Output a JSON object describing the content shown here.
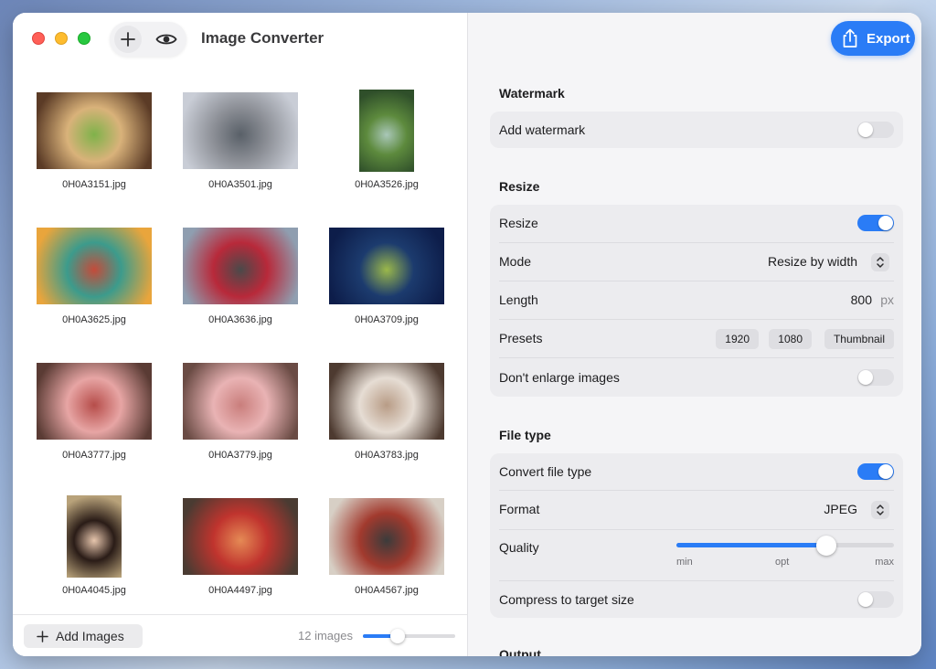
{
  "app": {
    "title": "Image Converter"
  },
  "toolbar": {
    "add_icon": "plus-icon",
    "preview_icon": "eye-icon"
  },
  "export": {
    "label": "Export",
    "icon": "share-icon"
  },
  "images": [
    {
      "name": "0H0A3151.jpg",
      "subject": "noodle bowl",
      "colors": [
        "#5b3b26",
        "#d9b27a",
        "#7fb24a"
      ]
    },
    {
      "name": "0H0A3501.jpg",
      "subject": "city buildings",
      "colors": [
        "#c9cdd6",
        "#8c8f96",
        "#596068"
      ]
    },
    {
      "name": "0H0A3526.jpg",
      "subject": "water basin moss",
      "colors": [
        "#2f4f2a",
        "#5d8a3d",
        "#a9c7b8"
      ]
    },
    {
      "name": "0H0A3625.jpg",
      "subject": "yellow fruits",
      "colors": [
        "#e9a53c",
        "#3c9b8c",
        "#c44b3a"
      ]
    },
    {
      "name": "0H0A3636.jpg",
      "subject": "red train",
      "colors": [
        "#8f9eb0",
        "#b8293a",
        "#4a4a4a"
      ]
    },
    {
      "name": "0H0A3709.jpg",
      "subject": "tree at night",
      "colors": [
        "#0d1d4a",
        "#1c3b6e",
        "#9bb84a"
      ]
    },
    {
      "name": "0H0A3777.jpg",
      "subject": "dried fish",
      "colors": [
        "#5a3b34",
        "#e7a5a4",
        "#b64d4a"
      ]
    },
    {
      "name": "0H0A3779.jpg",
      "subject": "dried fish rows",
      "colors": [
        "#6a4b44",
        "#e9b3b4",
        "#c97e7c"
      ]
    },
    {
      "name": "0H0A3783.jpg",
      "subject": "dried squid",
      "colors": [
        "#4d3a30",
        "#e6ddd4",
        "#b89c86"
      ]
    },
    {
      "name": "0H0A4045.jpg",
      "subject": "portrait",
      "colors": [
        "#b8a27a",
        "#2a1c17",
        "#e7c6ad"
      ]
    },
    {
      "name": "0H0A4497.jpg",
      "subject": "rice bowl",
      "colors": [
        "#4a3b32",
        "#c0342e",
        "#e58a55"
      ]
    },
    {
      "name": "0H0A4567.jpg",
      "subject": "record player",
      "colors": [
        "#d7cfc5",
        "#a23a2e",
        "#3b3b3b"
      ]
    }
  ],
  "footer": {
    "add_images_label": "Add Images",
    "count_label": "12 images",
    "zoom_level": 0.38
  },
  "watermark": {
    "section_title": "Watermark",
    "add_label": "Add watermark",
    "add_on": false
  },
  "resize": {
    "section_title": "Resize",
    "resize_label": "Resize",
    "resize_on": true,
    "mode_label": "Mode",
    "mode_value": "Resize by width",
    "length_label": "Length",
    "length_value": "800",
    "length_unit": "px",
    "presets_label": "Presets",
    "presets": [
      "1920",
      "1080",
      "Thumbnail"
    ],
    "no_enlarge_label": "Don't enlarge images",
    "no_enlarge_on": false
  },
  "file_type": {
    "section_title": "File type",
    "convert_label": "Convert file type",
    "convert_on": true,
    "format_label": "Format",
    "format_value": "JPEG",
    "quality_label": "Quality",
    "quality_value": 0.69,
    "quality_min": "min",
    "quality_opt": "opt",
    "quality_max": "max",
    "compress_label": "Compress to target size",
    "compress_on": false
  },
  "output": {
    "section_title": "Output"
  },
  "colors": {
    "accent": "#2a7cf6"
  }
}
